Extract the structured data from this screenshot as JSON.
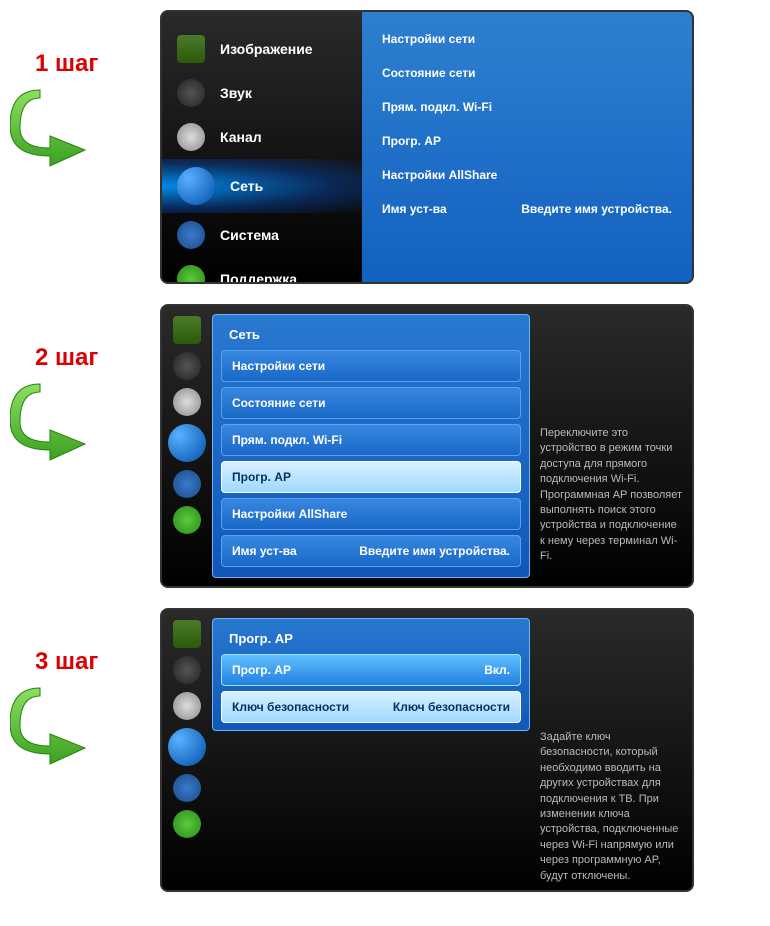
{
  "steps": [
    {
      "label": "1 шаг"
    },
    {
      "label": "2 шаг"
    },
    {
      "label": "3 шаг"
    }
  ],
  "main_menu": {
    "picture": "Изображение",
    "sound": "Звук",
    "channel": "Канал",
    "network": "Сеть",
    "system": "Система",
    "support": "Поддержка"
  },
  "network_submenu": {
    "settings": "Настройки сети",
    "status": "Состояние сети",
    "direct_wifi": "Прям. подкл. Wi-Fi",
    "soft_ap": "Прогр. AP",
    "allshare": "Настройки AllShare",
    "device_name_label": "Имя уст-ва",
    "device_name_value": "Введите имя устройства."
  },
  "step2": {
    "title": "Сеть",
    "items": {
      "settings": "Настройки сети",
      "status": "Состояние сети",
      "direct_wifi": "Прям. подкл. Wi-Fi",
      "soft_ap": "Прогр. AP",
      "allshare": "Настройки AllShare",
      "device_name_label": "Имя уст-ва",
      "device_name_value": "Введите имя устройства."
    },
    "help": "Переключите это устройство в режим точки доступа для прямого подключения Wi-Fi. Программная AP позволяет выполнять поиск этого устройства и подключение к нему через терминал Wi-Fi."
  },
  "step3": {
    "title": "Прогр. AP",
    "soft_ap_label": "Прогр. AP",
    "soft_ap_value": "Вкл.",
    "sec_key_label": "Ключ безопасности",
    "sec_key_value": "Ключ безопасности",
    "help": "Задайте ключ безопасности, который необходимо вводить на других устройствах для подключения к ТВ. При изменении ключа устройства, подключенные через Wi-Fi напрямую или через программную AP, будут отключены."
  }
}
